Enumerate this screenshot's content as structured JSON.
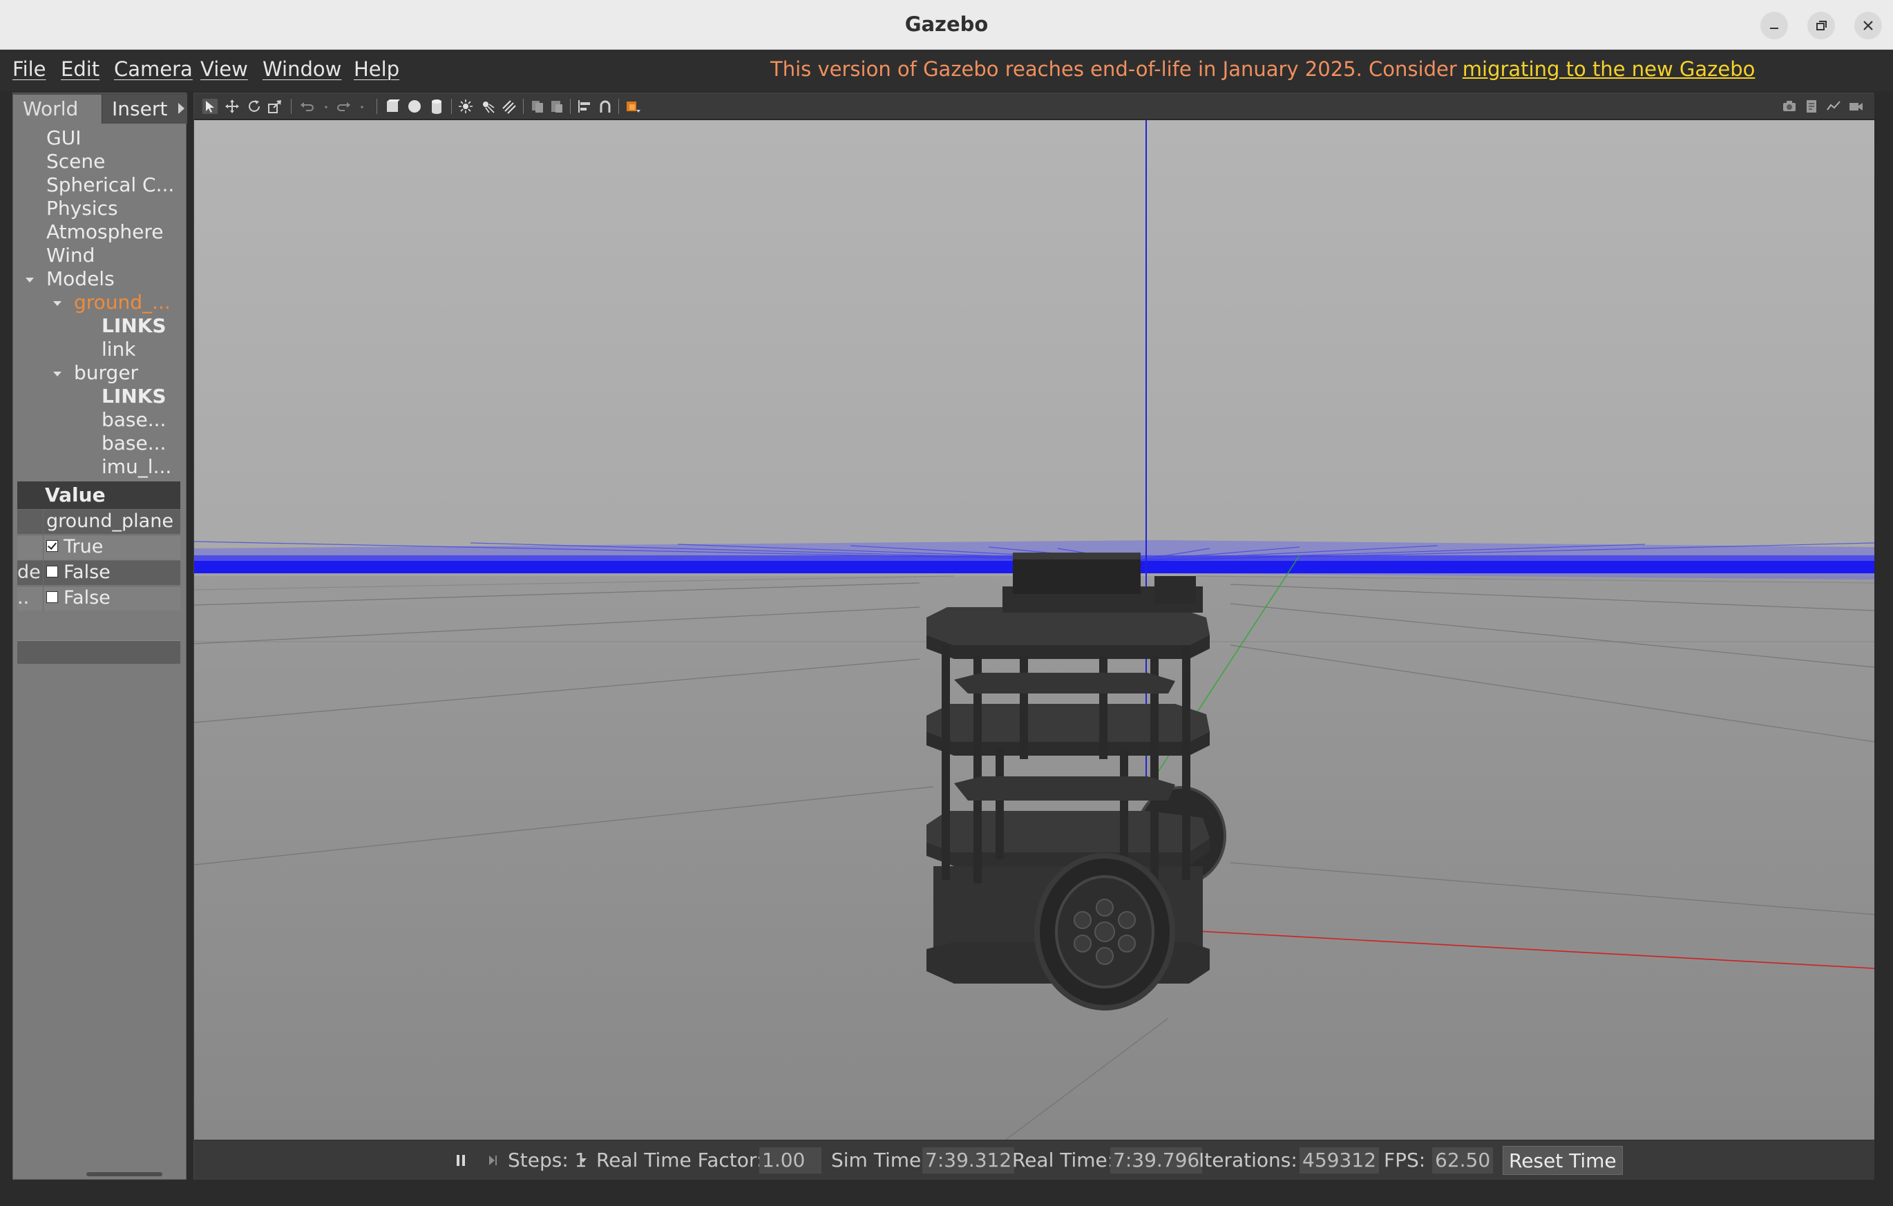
{
  "window": {
    "title": "Gazebo"
  },
  "menu": {
    "items": [
      "File",
      "Edit",
      "Camera",
      "View",
      "Window",
      "Help"
    ],
    "notice_text": "This version of Gazebo reaches end-of-life in January 2025. Consider",
    "notice_link": "migrating to the new Gazebo",
    "notice_color": "#f0905e",
    "link_color": "#f5d22b"
  },
  "left_panel": {
    "tabs": [
      "World",
      "Insert"
    ],
    "tree": [
      "GUI",
      "Scene",
      "Spherical C...",
      "Physics",
      "Atmosphere",
      "Wind",
      "Models",
      "ground_...",
      "LINKS",
      "link",
      "burger",
      "LINKS",
      "base...",
      "base...",
      "imu_l..."
    ],
    "selected_color": "#f08c3a",
    "property_header": "Value",
    "properties": [
      {
        "key": "",
        "value": "ground_plane",
        "checkbox": null
      },
      {
        "key": "",
        "value": "True",
        "checkbox": true
      },
      {
        "key": "de",
        "value": "False",
        "checkbox": false
      },
      {
        "key": "..",
        "value": "False",
        "checkbox": false
      }
    ]
  },
  "toolbar": {
    "icons": [
      "select-mode-icon",
      "translate-mode-icon",
      "rotate-mode-icon",
      "scale-mode-icon",
      "undo-icon",
      "redo-icon",
      "box-shape-icon",
      "sphere-shape-icon",
      "cylinder-shape-icon",
      "point-light-icon",
      "spot-light-icon",
      "directional-light-icon",
      "copy-icon",
      "paste-icon",
      "align-icon",
      "snap-icon",
      "change-view-icon",
      "screenshot-icon",
      "log-icon",
      "plot-icon",
      "video-record-icon"
    ]
  },
  "bottom_bar": {
    "steps_label": "Steps: 1",
    "rtf_label": "Real Time Factor:",
    "rtf_value": "1.00",
    "sim_time_label": "Sim Time:",
    "sim_time_value": "7:39.312",
    "real_time_label": "Real Time:",
    "real_time_value": "7:39.796",
    "iterations_label": "Iterations:",
    "iterations_value": "459312",
    "fps_label": "FPS:",
    "fps_value": "62.50",
    "reset_label": "Reset Time"
  }
}
